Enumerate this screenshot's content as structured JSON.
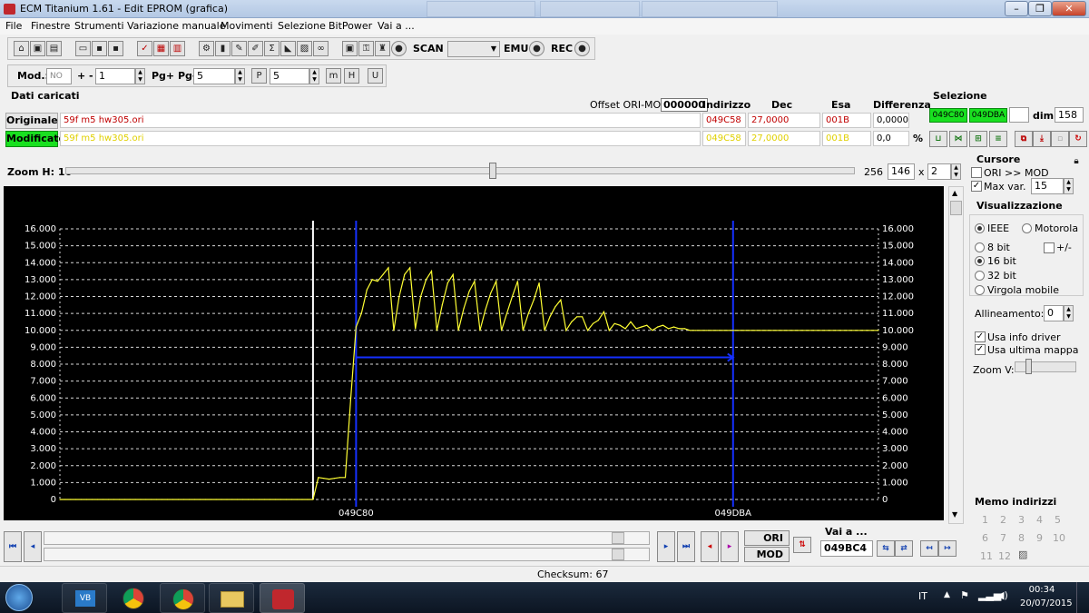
{
  "window": {
    "title": "ECM Titanium 1.61 - Edit EPROM (grafica)",
    "controls": [
      "–",
      "❐",
      "✕"
    ]
  },
  "menu": [
    "File",
    "Finestre",
    "Strumenti",
    "Variazione manuale",
    "Movimenti",
    "Selezione",
    "BitPower",
    "Vai a ..."
  ],
  "toolbar1": {
    "scan_label": "SCAN",
    "emu_label": "EMU",
    "rec_label": "REC",
    "icons": [
      "home-icon",
      "save-icon",
      "disk-icon",
      "copy-icon",
      "open-folder-icon",
      "floppy-icon",
      "floppy2-icon",
      "checklist-icon",
      "calc-icon",
      "doc-icon",
      "chip-icon",
      "phone-icon",
      "wrench-icon",
      "pencil-icon",
      "sigma-icon",
      "chart-icon",
      "binoculars-icon",
      "window-icon",
      "lock-icon",
      "runner-icon",
      "record-icon"
    ]
  },
  "toolbar2": {
    "mod_label": "Mod.:",
    "mod_value": "NO",
    "plusminus_label": "+ -",
    "plusminus_value": "1",
    "pg_label": "Pg+ Pg-",
    "pg_value": "5",
    "p_value": "5"
  },
  "loaded": {
    "section_title": "Dati caricati",
    "offset_label": "Offset ORI-MOD",
    "offset_value": "000000",
    "headers": {
      "indirizzo": "Indirizzo",
      "dec": "Dec",
      "esa": "Esa",
      "diff": "Differenza"
    },
    "rows": [
      {
        "label": "Originale",
        "file": "59f m5 hw305.ori",
        "addr": "049C58",
        "dec": "27,0000",
        "esa": "001B",
        "diff": "0,0000",
        "unit": ""
      },
      {
        "label": "Modificato",
        "file": "59f m5 hw305.ori",
        "addr": "049C58",
        "dec": "27,0000",
        "esa": "001B",
        "diff": "0,0",
        "unit": "%"
      }
    ]
  },
  "selection": {
    "title": "Selezione",
    "start": "049C80",
    "end": "049DBA",
    "dim_label": "dim.",
    "dim_value": "158"
  },
  "zoom": {
    "label": "Zoom H: 16",
    "min_label": "256",
    "value": "146",
    "x_label": "x",
    "mult": "2"
  },
  "cursor_panel": {
    "title": "Cursore",
    "ori_mod_label": "ORI >> MOD",
    "ori_mod_checked": false,
    "maxvar_label": "Max var.",
    "maxvar_checked": true,
    "maxvar_value": "15"
  },
  "view_panel": {
    "title": "Visualizzazione",
    "ieee_label": "IEEE",
    "motorola_label": "Motorola",
    "bit8_label": "8 bit",
    "plusminus_label": "+/-",
    "bit16_label": "16 bit",
    "bit32_label": "32 bit",
    "float_label": "Virgola mobile",
    "align_label": "Allineamento:",
    "align_value": "0",
    "driver_label": "Usa info driver",
    "lastmap_label": "Usa ultima mappa",
    "zoomv_label": "Zoom V:",
    "selected": "16 bit",
    "byte_order": "IEEE"
  },
  "memo": {
    "title": "Memo indirizzi",
    "numbers": [
      "1",
      "2",
      "3",
      "4",
      "5",
      "6",
      "7",
      "8",
      "9",
      "10",
      "11",
      "12"
    ]
  },
  "goto": {
    "title": "Vai a ...",
    "value": "049BC4",
    "ori_label": "ORI",
    "mod_label": "MOD"
  },
  "status": {
    "checksum": "Checksum: 67"
  },
  "taskbar": {
    "lang": "IT",
    "time": "00:34",
    "date": "20/07/2015"
  },
  "chart_data": {
    "type": "line",
    "yticks": [
      "0",
      "1.000",
      "2.000",
      "3.000",
      "4.000",
      "5.000",
      "6.000",
      "7.000",
      "8.000",
      "9.000",
      "10.000",
      "11.000",
      "12.000",
      "13.000",
      "14.000",
      "15.000",
      "16.000"
    ],
    "ylim": [
      0,
      16000
    ],
    "markers": [
      {
        "label": "049C80"
      },
      {
        "label": "049DBA"
      }
    ],
    "series": [
      {
        "values": [
          0,
          0,
          0,
          0,
          0,
          0,
          0,
          0,
          0,
          0,
          0,
          0,
          0,
          0,
          0,
          0,
          0,
          0,
          0,
          0,
          0,
          0,
          0,
          0,
          0,
          0,
          0,
          0,
          0,
          0,
          0,
          0,
          0,
          0,
          0,
          0,
          0,
          0,
          0,
          0,
          0,
          0,
          0,
          0,
          0,
          0,
          0,
          0,
          1300,
          1250,
          1200,
          1250,
          1300,
          1300,
          5900,
          10200,
          11000,
          12400,
          13000,
          12900,
          13300,
          13700,
          10000,
          12000,
          13300,
          13700,
          10100,
          12000,
          13000,
          13500,
          10000,
          11500,
          12800,
          13300,
          10000,
          11300,
          12300,
          12900,
          10000,
          11200,
          12200,
          12900,
          10000,
          11000,
          12000,
          12900,
          10000,
          11000,
          11800,
          12800,
          10000,
          10800,
          11400,
          11800,
          10000,
          10500,
          10800,
          10800,
          10000,
          10400,
          10600,
          11100,
          10000,
          10400,
          10300,
          10100,
          10500,
          10100,
          10200,
          10300,
          10000,
          10200,
          10300,
          10100,
          10200,
          10100,
          10100,
          10000,
          10000,
          10000,
          10000,
          10000,
          10000,
          10000,
          10000,
          10000,
          10000,
          10000,
          10000,
          10000,
          10000,
          10000,
          10000,
          10000,
          10000,
          10000,
          10000,
          10000,
          10000,
          10000,
          10000,
          10000,
          10000,
          10000,
          10000,
          10000,
          10000,
          10000,
          10000,
          10000,
          10000,
          10000,
          10000
        ],
        "color": "#ffff33"
      }
    ],
    "cursor_index": 47,
    "selection_start_index": 55,
    "selection_end_index": 125,
    "colors": {
      "background": "#000000",
      "grid": "#d8d8d8",
      "line": "#ffff33",
      "cursor": "#ffffff",
      "selection": "#1530ff"
    }
  }
}
